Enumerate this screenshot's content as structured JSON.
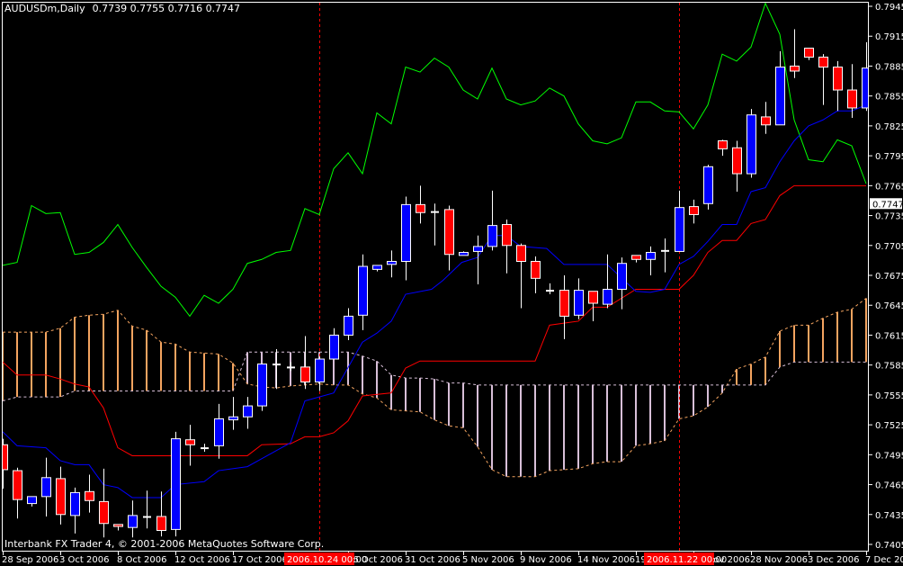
{
  "title": {
    "symbol_timeframe": "AUDUSDm,Daily",
    "ohlc": "0.7739 0.7755 0.7716 0.7747"
  },
  "footer": "Interbank FX Trader 4, © 2001-2006 MetaQuotes Software Corp.",
  "current_price_label": "0.7747",
  "colors": {
    "background": "#000000",
    "frame": "#FFFFFF",
    "bull_body": "#0000FF",
    "bear_body": "#FF0000",
    "wick": "#FFFFFF",
    "tenkan": "#0000FF",
    "kijun": "#FF0000",
    "chikou": "#00FF00",
    "senkou_a": "#F4A460",
    "senkou_b": "#D8BFD8",
    "separator": "#FF0000",
    "highlight_bg": "#FF0000"
  },
  "chart_data": {
    "type": "candlestick",
    "title": "AUDUSDm,Daily",
    "ylim": [
      0.7405,
      0.7945
    ],
    "y_ticks": [
      "0.7945",
      "0.7915",
      "0.7885",
      "0.7855",
      "0.7825",
      "0.7795",
      "0.7765",
      "0.7735",
      "0.7705",
      "0.7675",
      "0.7645",
      "0.7615",
      "0.7585",
      "0.7555",
      "0.7525",
      "0.7495",
      "0.7465",
      "0.7435",
      "0.7405"
    ],
    "x_ticks": [
      {
        "bar": 0,
        "label": "28 Sep 2006"
      },
      {
        "bar": 4,
        "label": "3 Oct 2006"
      },
      {
        "bar": 8,
        "label": "8 Oct 2006"
      },
      {
        "bar": 12,
        "label": "12 Oct 2006"
      },
      {
        "bar": 16,
        "label": "17 Oct 2006"
      },
      {
        "bar": 24,
        "label": "26 Oct 2006"
      },
      {
        "bar": 28,
        "label": "31 Oct 2006"
      },
      {
        "bar": 32,
        "label": "5 Nov 2006"
      },
      {
        "bar": 36,
        "label": "9 Nov 2006"
      },
      {
        "bar": 40,
        "label": "14 Nov 2006"
      },
      {
        "bar": 44,
        "label": "19 Nov 2006"
      },
      {
        "bar": 48,
        "label": "24 Nov 2006"
      },
      {
        "bar": 52,
        "label": "28 Nov 2006"
      },
      {
        "bar": 56,
        "label": "3 Dec 2006"
      },
      {
        "bar": 60,
        "label": "7 Dec 2006"
      }
    ],
    "separators": [
      {
        "bar": 22,
        "label": "2006.10.24 00:00"
      },
      {
        "bar": 47,
        "label": "2006.11.22 00:00"
      }
    ],
    "current_price": 0.7747,
    "candles_ohlc": [
      [
        0.7505,
        0.7511,
        0.7461,
        0.748
      ],
      [
        0.7479,
        0.7482,
        0.7431,
        0.745
      ],
      [
        0.7446,
        0.7453,
        0.7443,
        0.7453
      ],
      [
        0.7453,
        0.7492,
        0.7433,
        0.7472
      ],
      [
        0.7471,
        0.7483,
        0.7425,
        0.7435
      ],
      [
        0.7434,
        0.7462,
        0.7416,
        0.7457
      ],
      [
        0.7458,
        0.7475,
        0.7437,
        0.7449
      ],
      [
        0.7448,
        0.7481,
        0.7412,
        0.7426
      ],
      [
        0.7425,
        0.7425,
        0.7419,
        0.7423
      ],
      [
        0.7422,
        0.7449,
        0.7412,
        0.7434
      ],
      [
        0.7433,
        0.7459,
        0.7421,
        0.7433
      ],
      [
        0.7433,
        0.7458,
        0.7413,
        0.7419
      ],
      [
        0.742,
        0.7518,
        0.7413,
        0.7511
      ],
      [
        0.751,
        0.7525,
        0.7484,
        0.7505
      ],
      [
        0.7502,
        0.7506,
        0.7498,
        0.7502
      ],
      [
        0.7504,
        0.7546,
        0.7491,
        0.7531
      ],
      [
        0.753,
        0.7553,
        0.752,
        0.7533
      ],
      [
        0.7533,
        0.7553,
        0.7521,
        0.7544
      ],
      [
        0.7544,
        0.7586,
        0.7539,
        0.7586
      ],
      [
        0.7586,
        0.7601,
        0.7561,
        0.7586
      ],
      [
        0.7583,
        0.7588,
        0.7579,
        0.7583
      ],
      [
        0.7583,
        0.7614,
        0.7561,
        0.7568
      ],
      [
        0.7568,
        0.7593,
        0.7559,
        0.7591
      ],
      [
        0.7591,
        0.7622,
        0.7591,
        0.7615
      ],
      [
        0.7615,
        0.7642,
        0.761,
        0.7634
      ],
      [
        0.7635,
        0.7696,
        0.762,
        0.7684
      ],
      [
        0.7681,
        0.7685,
        0.7679,
        0.7685
      ],
      [
        0.7686,
        0.77,
        0.7673,
        0.7689
      ],
      [
        0.7689,
        0.7754,
        0.767,
        0.7746
      ],
      [
        0.7746,
        0.7765,
        0.7727,
        0.7738
      ],
      [
        0.7737,
        0.7747,
        0.7705,
        0.7739
      ],
      [
        0.7741,
        0.7745,
        0.768,
        0.7696
      ],
      [
        0.7695,
        0.7699,
        0.7695,
        0.7698
      ],
      [
        0.7699,
        0.7715,
        0.7666,
        0.7704
      ],
      [
        0.7704,
        0.776,
        0.77,
        0.7725
      ],
      [
        0.7726,
        0.7731,
        0.7677,
        0.7705
      ],
      [
        0.7705,
        0.7707,
        0.7642,
        0.7689
      ],
      [
        0.7689,
        0.7694,
        0.7657,
        0.7672
      ],
      [
        0.7662,
        0.7667,
        0.7656,
        0.766
      ],
      [
        0.766,
        0.7675,
        0.7611,
        0.7634
      ],
      [
        0.7635,
        0.7672,
        0.7631,
        0.766
      ],
      [
        0.7659,
        0.7659,
        0.7629,
        0.7647
      ],
      [
        0.7646,
        0.7696,
        0.7642,
        0.7661
      ],
      [
        0.7661,
        0.7693,
        0.7641,
        0.7687
      ],
      [
        0.7695,
        0.7695,
        0.7688,
        0.7691
      ],
      [
        0.7691,
        0.7704,
        0.7675,
        0.7698
      ],
      [
        0.7698,
        0.7712,
        0.7678,
        0.77
      ],
      [
        0.7699,
        0.776,
        0.7699,
        0.7743
      ],
      [
        0.7744,
        0.7751,
        0.7727,
        0.7736
      ],
      [
        0.7747,
        0.7786,
        0.7741,
        0.7784
      ],
      [
        0.781,
        0.7811,
        0.7795,
        0.7802
      ],
      [
        0.7803,
        0.781,
        0.7759,
        0.7777
      ],
      [
        0.7777,
        0.7842,
        0.7773,
        0.7836
      ],
      [
        0.7834,
        0.7849,
        0.7817,
        0.7826
      ],
      [
        0.7826,
        0.79,
        0.7826,
        0.7884
      ],
      [
        0.7885,
        0.7922,
        0.7873,
        0.788
      ],
      [
        0.7903,
        0.7903,
        0.7891,
        0.7894
      ],
      [
        0.7894,
        0.7897,
        0.7846,
        0.7884
      ],
      [
        0.7884,
        0.789,
        0.784,
        0.7861
      ],
      [
        0.7861,
        0.7887,
        0.7833,
        0.7843
      ],
      [
        0.7843,
        0.7909,
        0.784,
        0.7883
      ]
    ],
    "tenkan_sen": [
      [
        0,
        0.7518
      ],
      [
        1,
        0.7504
      ],
      [
        3,
        0.7502
      ],
      [
        4,
        0.7489
      ],
      [
        5,
        0.7485
      ],
      [
        6,
        0.7485
      ],
      [
        7,
        0.7465
      ],
      [
        8,
        0.7462
      ],
      [
        9,
        0.7452
      ],
      [
        11,
        0.7452
      ],
      [
        12,
        0.7465
      ],
      [
        14,
        0.7468
      ],
      [
        15,
        0.7479
      ],
      [
        17,
        0.7483
      ],
      [
        20,
        0.7507
      ],
      [
        21,
        0.7549
      ],
      [
        22,
        0.7553
      ],
      [
        23,
        0.7557
      ],
      [
        25,
        0.7608
      ],
      [
        26,
        0.7617
      ],
      [
        27,
        0.7629
      ],
      [
        28,
        0.7656
      ],
      [
        29.8,
        0.7661
      ],
      [
        30.6,
        0.767
      ],
      [
        31.9,
        0.7688
      ],
      [
        33,
        0.7693
      ],
      [
        34,
        0.7715
      ],
      [
        35,
        0.7715
      ],
      [
        36,
        0.7704
      ],
      [
        37.8,
        0.7702
      ],
      [
        39,
        0.7686
      ],
      [
        42,
        0.7686
      ],
      [
        43.4,
        0.7667
      ],
      [
        44,
        0.7659
      ],
      [
        45,
        0.7658
      ],
      [
        46,
        0.7661
      ],
      [
        47,
        0.7686
      ],
      [
        48,
        0.7694
      ],
      [
        49,
        0.7709
      ],
      [
        50,
        0.7726
      ],
      [
        51,
        0.7726
      ],
      [
        52,
        0.7759
      ],
      [
        53,
        0.7763
      ],
      [
        54,
        0.7789
      ],
      [
        55,
        0.781
      ],
      [
        56,
        0.7825
      ],
      [
        57,
        0.7831
      ],
      [
        58,
        0.784
      ],
      [
        59,
        0.784
      ],
      [
        60,
        0.7846
      ]
    ],
    "kijun_sen": [
      [
        0,
        0.7588
      ],
      [
        1,
        0.7575
      ],
      [
        3,
        0.7575
      ],
      [
        4,
        0.7571
      ],
      [
        5,
        0.7566
      ],
      [
        6,
        0.7563
      ],
      [
        7,
        0.7542
      ],
      [
        8,
        0.7502
      ],
      [
        9,
        0.7494
      ],
      [
        17,
        0.7494
      ],
      [
        18,
        0.7505
      ],
      [
        20,
        0.7506
      ],
      [
        21,
        0.7513
      ],
      [
        22,
        0.7513
      ],
      [
        23,
        0.7517
      ],
      [
        24,
        0.7529
      ],
      [
        25,
        0.7554
      ],
      [
        27,
        0.7557
      ],
      [
        28,
        0.7582
      ],
      [
        29,
        0.7589
      ],
      [
        37,
        0.7589
      ],
      [
        38,
        0.7625
      ],
      [
        40,
        0.7629
      ],
      [
        41,
        0.7643
      ],
      [
        42,
        0.7643
      ],
      [
        44,
        0.7661
      ],
      [
        47,
        0.7661
      ],
      [
        48,
        0.7675
      ],
      [
        49,
        0.7698
      ],
      [
        50,
        0.771
      ],
      [
        51,
        0.771
      ],
      [
        52,
        0.7727
      ],
      [
        53,
        0.7731
      ],
      [
        54,
        0.7755
      ],
      [
        55,
        0.7765
      ],
      [
        60,
        0.7765
      ]
    ],
    "chikou_span": [
      0.7685,
      0.7688,
      0.7745,
      0.7737,
      0.7738,
      0.7696,
      0.7698,
      0.7708,
      0.7726,
      0.7703,
      0.7683,
      0.7664,
      0.7653,
      0.7634,
      0.7655,
      0.7647,
      0.7661,
      0.7687,
      0.7691,
      0.7698,
      0.77,
      0.7742,
      0.7736,
      0.7782,
      0.7798,
      0.7777,
      0.7838,
      0.7827,
      0.7884,
      0.7879,
      0.7893,
      0.7884,
      0.7861,
      0.7852,
      0.7883,
      0.7852,
      0.7846,
      0.785,
      0.7863,
      0.7855,
      0.7827,
      0.781,
      0.7807,
      0.7813,
      0.7849,
      0.7849,
      0.784,
      0.7839,
      0.7822,
      0.7846,
      0.7897,
      0.789,
      0.7904,
      0.7948,
      0.7917,
      0.7831,
      0.7791,
      0.7789,
      0.7811,
      0.7805,
      0.7767
    ],
    "senkou_span_a": [
      0.7618,
      0.7618,
      0.7618,
      0.7618,
      0.7622,
      0.7633,
      0.7635,
      0.7636,
      0.764,
      0.7624,
      0.762,
      0.7608,
      0.7606,
      0.7598,
      0.7597,
      0.7596,
      0.7587,
      0.7566,
      0.7563,
      0.7562,
      0.7564,
      0.7565,
      0.7566,
      0.7565,
      0.7565,
      0.7556,
      0.7552,
      0.754,
      0.7539,
      0.7538,
      0.753,
      0.7524,
      0.7522,
      0.7503,
      0.748,
      0.7473,
      0.7473,
      0.7473,
      0.7479,
      0.748,
      0.7481,
      0.7486,
      0.7488,
      0.7488,
      0.7504,
      0.7506,
      0.7509,
      0.7531,
      0.7534,
      0.7543,
      0.7557,
      0.7581,
      0.7586,
      0.7593,
      0.7619,
      0.7625,
      0.7625,
      0.7632,
      0.7638,
      0.7641,
      0.7652
    ],
    "senkou_span_b": [
      0.7549,
      0.7553,
      0.7553,
      0.7553,
      0.7553,
      0.7559,
      0.7559,
      0.7559,
      0.7559,
      0.7559,
      0.7559,
      0.7559,
      0.7559,
      0.7559,
      0.7559,
      0.7559,
      0.7559,
      0.7598,
      0.7598,
      0.7598,
      0.7598,
      0.7598,
      0.7598,
      0.7598,
      0.7598,
      0.7594,
      0.7589,
      0.7575,
      0.7572,
      0.7572,
      0.7571,
      0.7567,
      0.7567,
      0.7565,
      0.7565,
      0.7565,
      0.7565,
      0.7565,
      0.7565,
      0.7565,
      0.7565,
      0.7565,
      0.7565,
      0.7565,
      0.7565,
      0.7565,
      0.7565,
      0.7565,
      0.7565,
      0.7565,
      0.7565,
      0.7565,
      0.7565,
      0.7565,
      0.7583,
      0.7588,
      0.7588,
      0.7588,
      0.7588,
      0.7588,
      0.7588
    ]
  }
}
